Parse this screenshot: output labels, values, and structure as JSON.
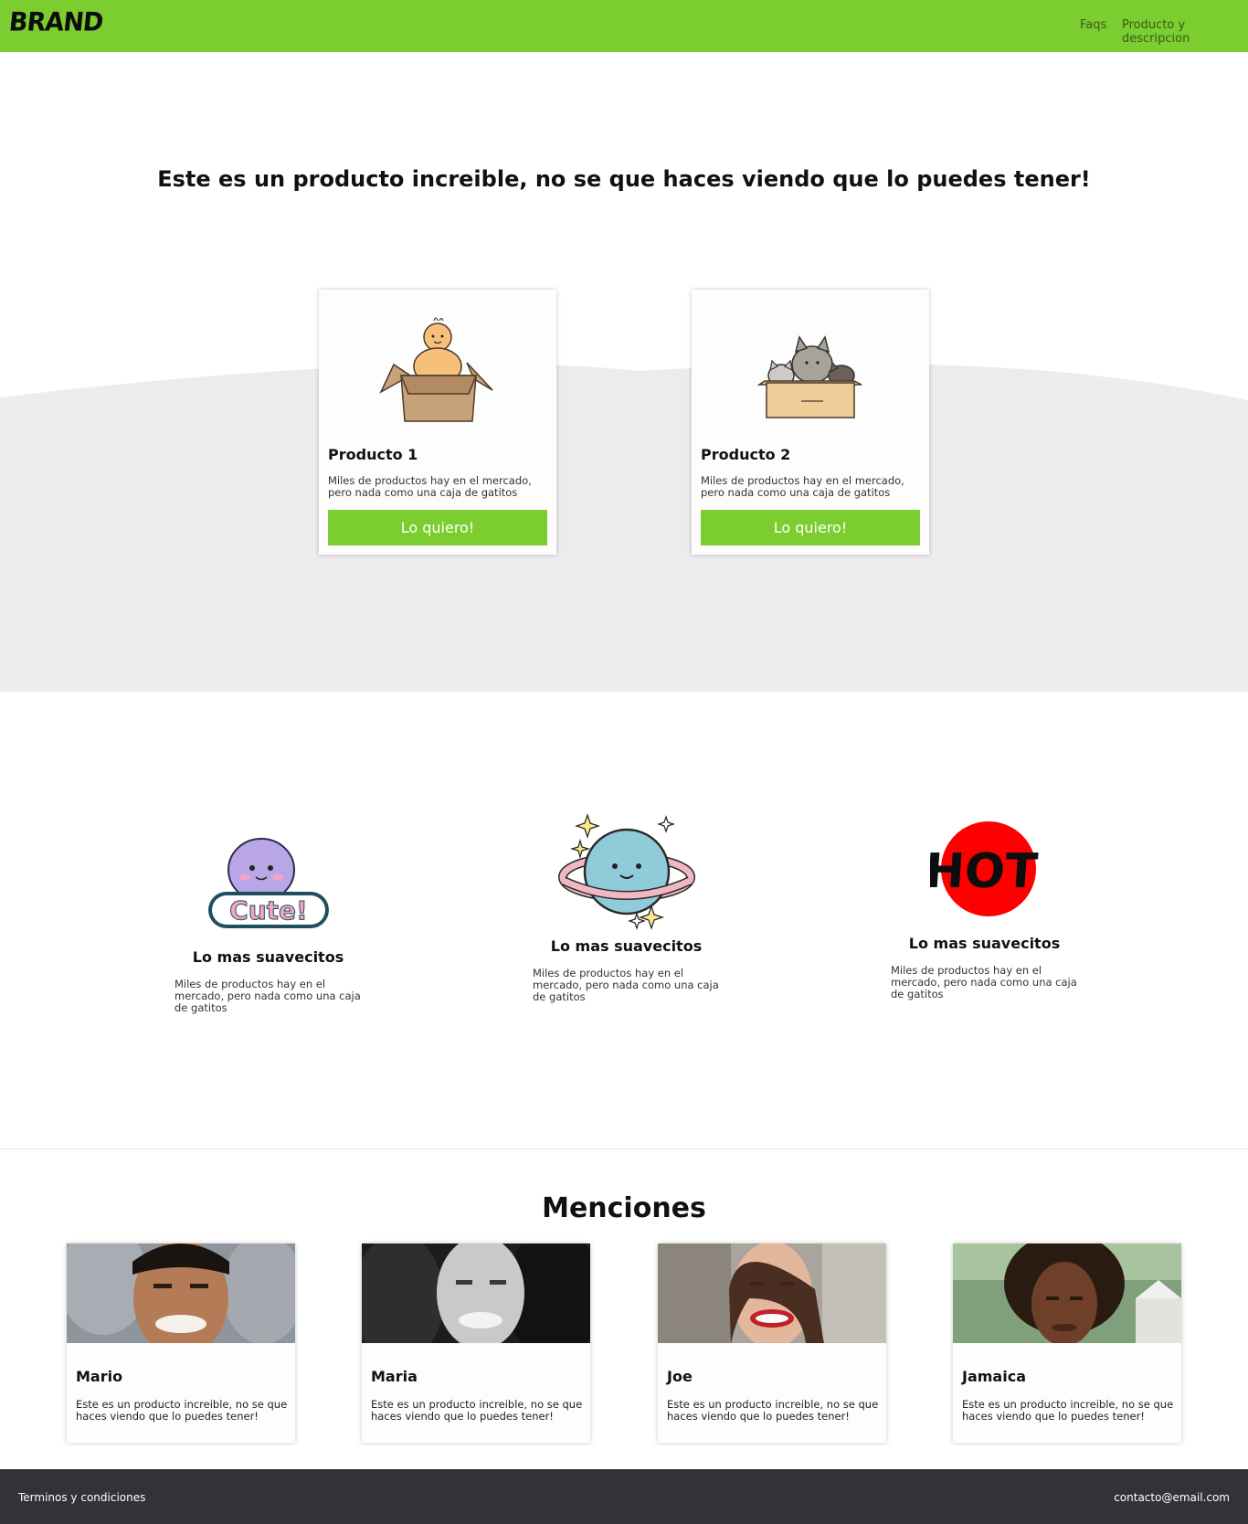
{
  "nav": {
    "brand": "BRAND",
    "links": [
      "Faqs",
      "Producto y descripcion"
    ]
  },
  "hero": {
    "title": "Este es un producto increible, no se que haces viendo que lo puedes tener!"
  },
  "products": [
    {
      "name": "Producto 1",
      "description": "Miles de productos hay en el mercado, pero nada como una caja de gatitos",
      "button": "Lo quiero!",
      "image": "baby-in-box-illustration"
    },
    {
      "name": "Producto 2",
      "description": "Miles de productos hay en el mercado, pero nada como una caja de gatitos",
      "button": "Lo quiero!",
      "image": "cats-in-box-illustration"
    }
  ],
  "features": [
    {
      "title": "Lo mas suavecitos",
      "description": "Miles de productos hay en el mercado, pero nada como una caja de gatitos",
      "image": "cute-sticker"
    },
    {
      "title": "Lo mas suavecitos",
      "description": "Miles de productos hay en el mercado, pero nada como una caja de gatitos",
      "image": "planet-sticker"
    },
    {
      "title": "Lo mas suavecitos",
      "description": "Miles de productos hay en el mercado, pero nada como una caja de gatitos",
      "image": "hot-sticker",
      "image_text": "HOT"
    }
  ],
  "mentions": {
    "title": "Menciones",
    "items": [
      {
        "name": "Mario",
        "text": "Este es un producto increible, no se que haces viendo que lo puedes tener!",
        "photo": "man-smiling-photo"
      },
      {
        "name": "Maria",
        "text": "Este es un producto increible, no se que haces viendo que lo puedes tener!",
        "photo": "woman-bw-smiling-photo"
      },
      {
        "name": "Joe",
        "text": "Este es un producto increible, no se que haces viendo que lo puedes tener!",
        "photo": "woman-laughing-photo"
      },
      {
        "name": "Jamaica",
        "text": "Este es un producto increible, no se que haces viendo que lo puedes tener!",
        "photo": "woman-curly-hair-photo"
      }
    ]
  },
  "footer": {
    "left": "Terminos y condiciones",
    "right": "contacto@email.com"
  },
  "colors": {
    "accent": "#7ccd2f",
    "footer": "#323336",
    "wave": "#ececec"
  }
}
